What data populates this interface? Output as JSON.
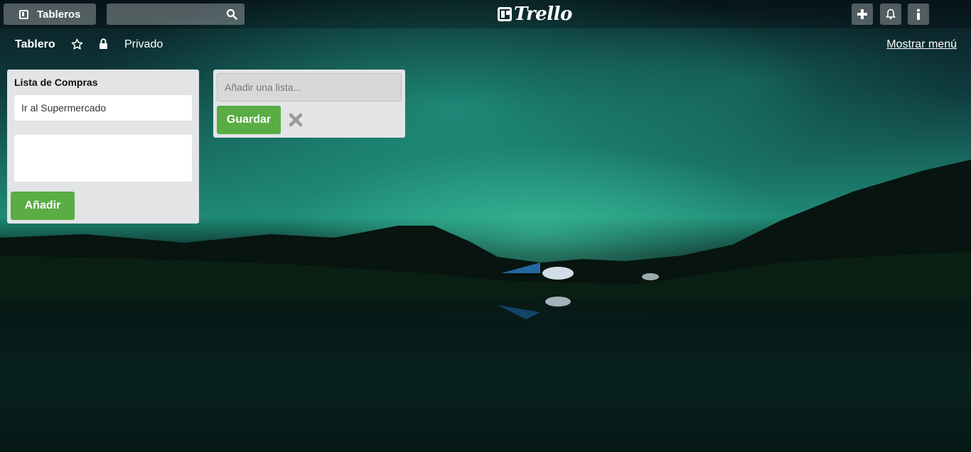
{
  "topbar": {
    "boards_label": "Tableros",
    "search_value": "",
    "logo_text": "Trello",
    "icons": [
      "boards-icon",
      "search-icon",
      "plus-icon",
      "bell-icon",
      "info-icon"
    ]
  },
  "board": {
    "title": "Tablero",
    "privacy": "Privado",
    "menu_label": "Mostrar menú"
  },
  "lists": [
    {
      "title": "Lista de Compras",
      "cards": [
        "Ir al Supermercado"
      ],
      "composer_value": "",
      "add_button": "Añadir"
    }
  ],
  "add_list": {
    "placeholder": "Añadir una lista...",
    "save_button": "Guardar"
  },
  "colors": {
    "accent_green": "#5aac44",
    "list_bg": "#e2e4e6"
  }
}
